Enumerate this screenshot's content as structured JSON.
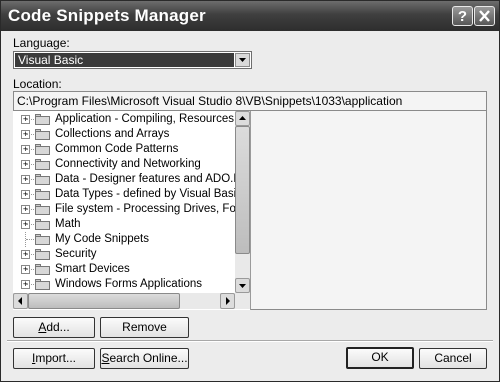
{
  "window": {
    "title": "Code Snippets Manager",
    "help_btn": "?",
    "close_btn": "X"
  },
  "language": {
    "label": "Language:",
    "selected": "Visual Basic"
  },
  "location": {
    "label": "Location:",
    "path": "C:\\Program Files\\Microsoft Visual Studio 8\\VB\\Snippets\\1033\\application"
  },
  "tree": {
    "items": [
      {
        "label": "Application - Compiling, Resources, and",
        "expandable": true
      },
      {
        "label": "Collections and Arrays",
        "expandable": true
      },
      {
        "label": "Common Code Patterns",
        "expandable": true
      },
      {
        "label": "Connectivity and Networking",
        "expandable": true
      },
      {
        "label": "Data - Designer features and ADO.NET",
        "expandable": true
      },
      {
        "label": "Data Types - defined by Visual Basic",
        "expandable": true
      },
      {
        "label": "File system - Processing Drives, Folders",
        "expandable": true
      },
      {
        "label": "Math",
        "expandable": true
      },
      {
        "label": "My Code Snippets",
        "expandable": false
      },
      {
        "label": "Security",
        "expandable": true
      },
      {
        "label": "Smart Devices",
        "expandable": true
      },
      {
        "label": "Windows Forms Applications",
        "expandable": true
      }
    ]
  },
  "buttons": {
    "add": "Add...",
    "remove": "Remove",
    "import": "Import...",
    "search_online": "Search Online...",
    "ok": "OK",
    "cancel": "Cancel"
  }
}
